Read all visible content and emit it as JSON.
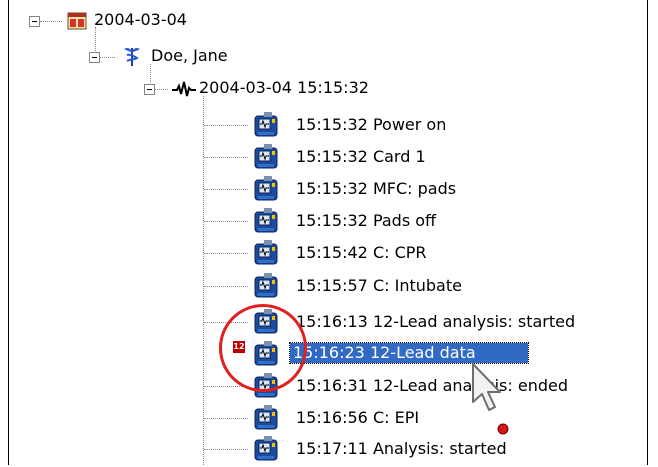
{
  "tree": {
    "root": {
      "label": "2004-03-04",
      "expanded": true
    },
    "patient": {
      "label": "Doe, Jane",
      "expanded": true
    },
    "session": {
      "label": "2004-03-04 15:15:32",
      "expanded": true
    },
    "events": [
      {
        "label": "15:15:32 Power on"
      },
      {
        "label": "15:15:32 Card 1"
      },
      {
        "label": "15:15:32 MFC: pads"
      },
      {
        "label": "15:15:32 Pads off"
      },
      {
        "label": "15:15:42 C: CPR"
      },
      {
        "label": "15:15:57 C: Intubate"
      },
      {
        "label": "15:16:13 12-Lead analysis: started"
      },
      {
        "label": "15:16:23 12-Lead data",
        "selected": true,
        "badge": "12"
      },
      {
        "label": "15:16:31 12-Lead analysis: ended"
      },
      {
        "label": "15:16:56 C: EPI"
      },
      {
        "label": "15:17:11 Analysis: started"
      }
    ]
  },
  "colors": {
    "selection": "#316ac5",
    "highlight_circle": "#e02020"
  },
  "icons": {
    "root": "calendar-icon",
    "patient": "caduceus-icon",
    "session": "ecg-waveform-icon",
    "event": "defibrillator-device-icon",
    "pointer": "mouse-cursor-icon"
  }
}
